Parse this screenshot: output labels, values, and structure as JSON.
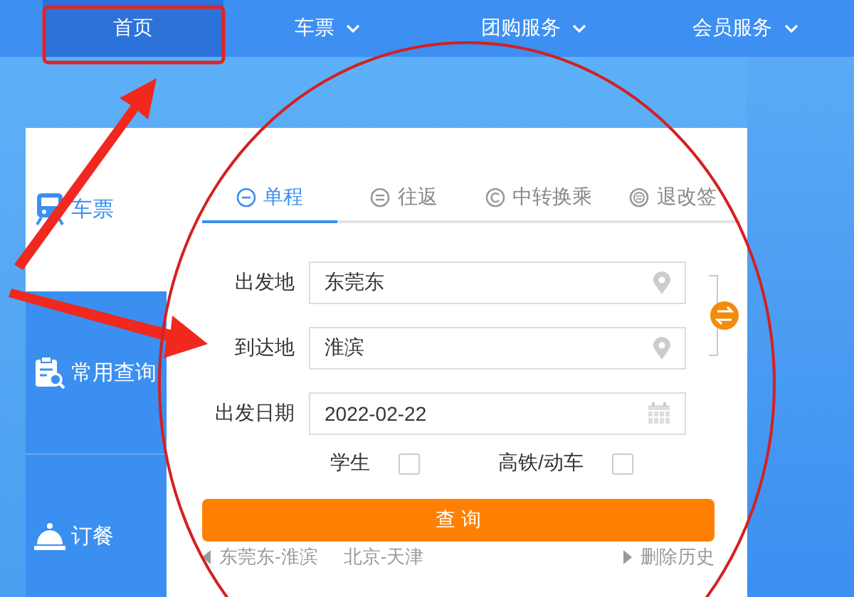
{
  "nav": [
    {
      "label": "首页",
      "selected": true,
      "dropdown": false
    },
    {
      "label": "车票",
      "selected": false,
      "dropdown": true
    },
    {
      "label": "团购服务",
      "selected": false,
      "dropdown": true
    },
    {
      "label": "会员服务",
      "selected": false,
      "dropdown": true
    }
  ],
  "sidebar": [
    {
      "label": "车票",
      "selected": true
    },
    {
      "label": "常用查询",
      "selected": false
    },
    {
      "label": "订餐",
      "selected": false
    }
  ],
  "trip_tabs": [
    {
      "label": "单程",
      "selected": true
    },
    {
      "label": "往返",
      "selected": false
    },
    {
      "label": "中转换乘",
      "selected": false
    },
    {
      "label": "退改签",
      "selected": false
    }
  ],
  "fields": [
    {
      "label": "出发地",
      "value": "东莞东",
      "kind": "station"
    },
    {
      "label": "到达地",
      "value": "淮滨",
      "kind": "station"
    },
    {
      "label": "出发日期",
      "value": "2022-02-22",
      "kind": "date"
    }
  ],
  "options": [
    {
      "label": "学生",
      "checked": false
    },
    {
      "label": "高铁/动车",
      "checked": false
    }
  ],
  "search_button": "查 询",
  "history": {
    "items": [
      "东莞东-淮滨",
      "北京-天津"
    ],
    "clear": "删除历史"
  }
}
